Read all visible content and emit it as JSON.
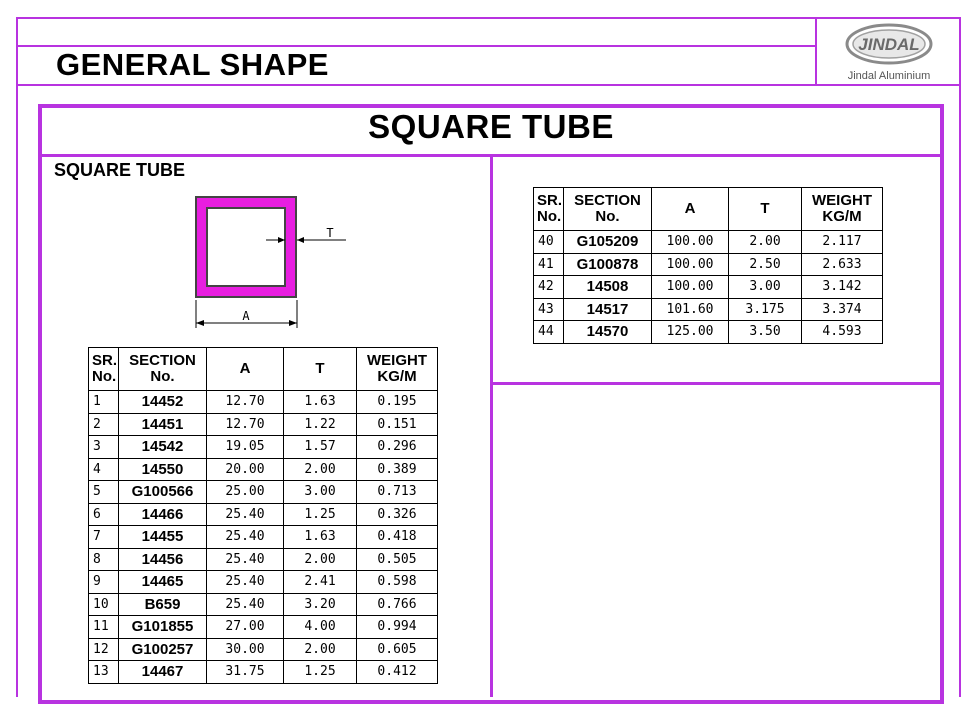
{
  "header": {
    "title": "GENERAL SHAPE",
    "logo_text": "JINDAL",
    "logo_subtext": "Jindal Aluminium"
  },
  "section": {
    "title": "SQUARE TUBE",
    "subtitle": "SQUARE TUBE"
  },
  "diagram": {
    "label_a": "A",
    "label_t": "T",
    "fill_color": "#e81ee0"
  },
  "colors": {
    "border": "#b833e0"
  },
  "table_headers": {
    "sr": "SR.",
    "no": "No.",
    "section": "SECTION",
    "section_no": "No.",
    "a": "A",
    "t": "T",
    "weight": "WEIGHT",
    "unit": "KG/M"
  },
  "table_left": [
    [
      "1",
      "14452",
      "12.70",
      "1.63",
      "0.195"
    ],
    [
      "2",
      "14451",
      "12.70",
      "1.22",
      "0.151"
    ],
    [
      "3",
      "14542",
      "19.05",
      "1.57",
      "0.296"
    ],
    [
      "4",
      "14550",
      "20.00",
      "2.00",
      "0.389"
    ],
    [
      "5",
      "G100566",
      "25.00",
      "3.00",
      "0.713"
    ],
    [
      "6",
      "14466",
      "25.40",
      "1.25",
      "0.326"
    ],
    [
      "7",
      "14455",
      "25.40",
      "1.63",
      "0.418"
    ],
    [
      "8",
      "14456",
      "25.40",
      "2.00",
      "0.505"
    ],
    [
      "9",
      "14465",
      "25.40",
      "2.41",
      "0.598"
    ],
    [
      "10",
      "B659",
      "25.40",
      "3.20",
      "0.766"
    ],
    [
      "11",
      "G101855",
      "27.00",
      "4.00",
      "0.994"
    ],
    [
      "12",
      "G100257",
      "30.00",
      "2.00",
      "0.605"
    ],
    [
      "13",
      "14467",
      "31.75",
      "1.25",
      "0.412"
    ]
  ],
  "table_right": [
    [
      "40",
      "G105209",
      "100.00",
      "2.00",
      "2.117"
    ],
    [
      "41",
      "G100878",
      "100.00",
      "2.50",
      "2.633"
    ],
    [
      "42",
      "14508",
      "100.00",
      "3.00",
      "3.142"
    ],
    [
      "43",
      "14517",
      "101.60",
      "3.175",
      "3.374"
    ],
    [
      "44",
      "14570",
      "125.00",
      "3.50",
      "4.593"
    ]
  ]
}
